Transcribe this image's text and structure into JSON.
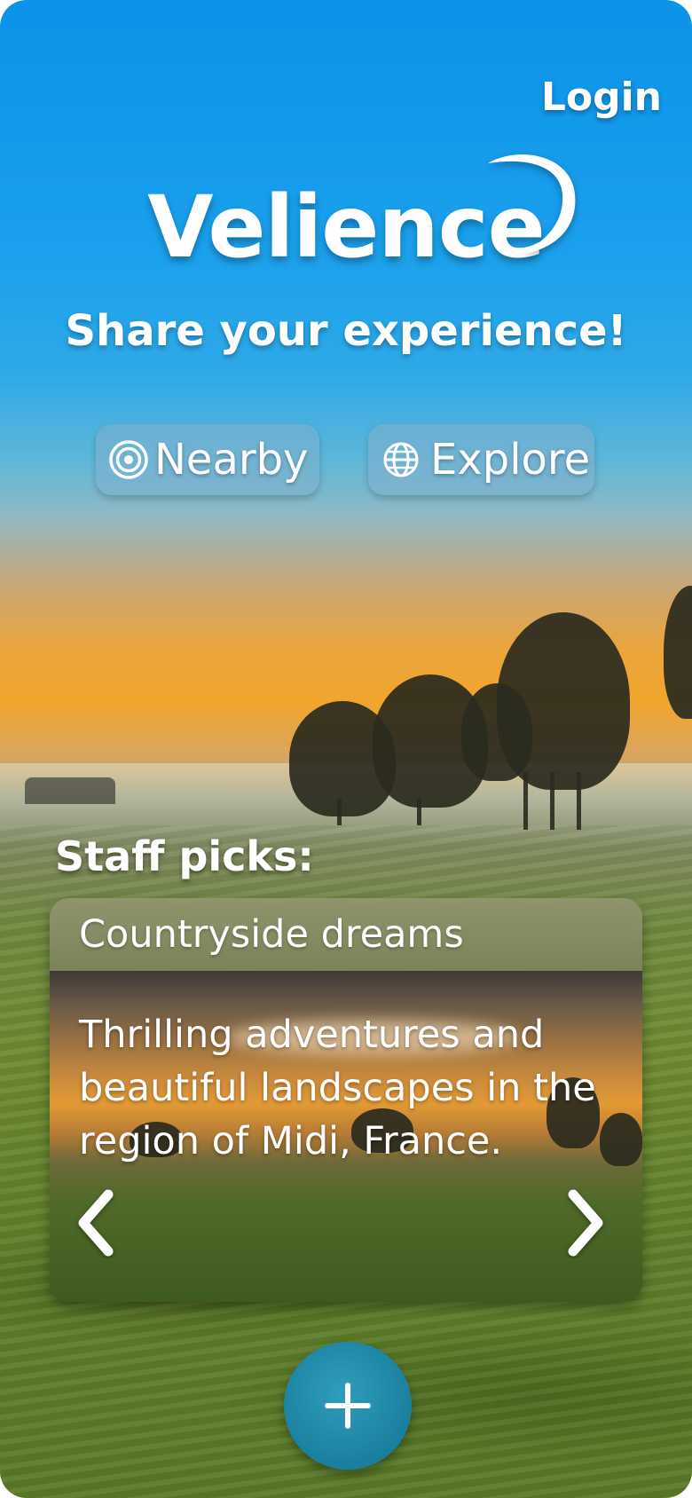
{
  "header": {
    "login_label": "Login"
  },
  "brand": {
    "name": "Velience",
    "tagline": "Share your experience!"
  },
  "nav": {
    "nearby_label": "Nearby",
    "nearby_icon": "target-icon",
    "explore_label": "Explore",
    "explore_icon": "globe-icon"
  },
  "staff_picks": {
    "heading": "Staff picks:",
    "card": {
      "title": "Countryside dreams",
      "description": "Thrilling adventures and beautiful landscapes in the region of Midi, France."
    },
    "prev_icon": "chevron-left-icon",
    "next_icon": "chevron-right-icon"
  },
  "fab": {
    "icon": "plus-icon"
  },
  "colors": {
    "sky": "#0b93e8",
    "fab": "#1a7f9f",
    "text": "#ffffff"
  }
}
